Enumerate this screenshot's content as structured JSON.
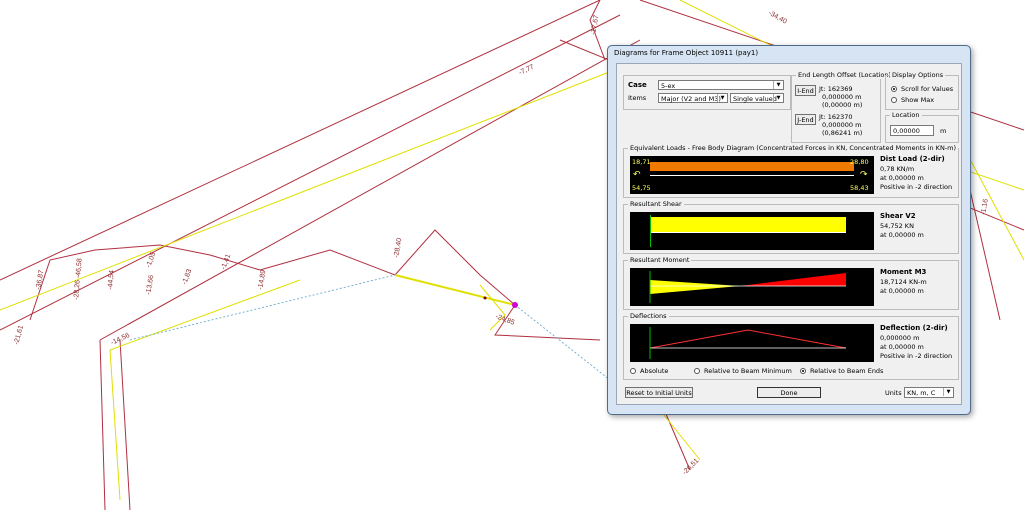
{
  "drawing": {
    "labels": [
      "-21,61",
      "-14,56",
      "-36,87",
      "-28,26 -46,58",
      "-44,54",
      "-13,66",
      "-1,83",
      "-1,05",
      "-1,41",
      "-14,89",
      "-24,85",
      "-28,40",
      "-26,51",
      "-7,77",
      "-17,67",
      "-34,40",
      "-1,16"
    ]
  },
  "dialog": {
    "title": "Diagrams for Frame Object 10911  (pay1)",
    "case_label": "Case",
    "case_value": "5-ex",
    "items_label": "Items",
    "items_value": "Major (V2 and M3)",
    "items_mode": "Single valued",
    "end_offset": {
      "group": "End Length Offset (Location)",
      "iend_btn": "I-End",
      "iend_jt": "Jt:  162369",
      "iend_v1": "0,000000 m",
      "iend_v2": "(0,00000 m)",
      "jend_btn": "J-End",
      "jend_jt": "Jt:  162370",
      "jend_v1": "0,000000 m",
      "jend_v2": "(0,86241 m)"
    },
    "display_options": {
      "group": "Display Options",
      "scroll": "Scroll for Values",
      "showmax": "Show Max"
    },
    "location": {
      "group": "Location",
      "value": "0,00000",
      "unit": "m"
    },
    "equiv": {
      "group": "Equivalent Loads - Free Body Diagram  (Concentrated Forces in KN, Concentrated Moments in KN-m)",
      "left_top": "18,71",
      "left_bot": "54,75",
      "right_top": "28,80",
      "right_bot": "58,43",
      "title": "Dist Load (2-dir)",
      "line1": "0,78 KN/m",
      "line2": "at 0,00000 m",
      "line3": "Positive in -2 direction",
      "load_color": "#f07a00"
    },
    "shear": {
      "group": "Resultant Shear",
      "title": "Shear V2",
      "line1": "54,752 KN",
      "line2": "at 0,00000 m",
      "color": "#ffff00"
    },
    "moment": {
      "group": "Resultant Moment",
      "title": "Moment M3",
      "line1": "18,7124 KN-m",
      "line2": "at 0,00000 m",
      "pos_color": "#ff0000",
      "neg_color": "#ffff00"
    },
    "deflection": {
      "group": "Deflections",
      "title": "Deflection (2-dir)",
      "line1": "0,000000 m",
      "line2": "at 0,00000 m",
      "line3": "Positive in -2 direction",
      "opt_abs": "Absolute",
      "opt_min": "Relative to Beam Minimum",
      "opt_ends": "Relative to Beam Ends"
    },
    "reset_btn": "Reset to Initial Units",
    "done_btn": "Done",
    "units_label": "Units",
    "units_value": "KN, m, C"
  }
}
